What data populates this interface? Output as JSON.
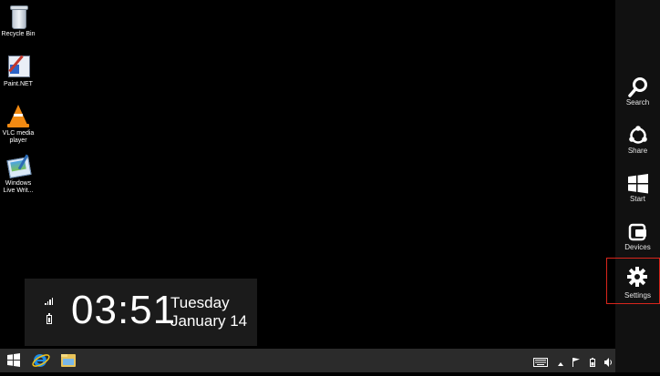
{
  "desktop": {
    "icons": [
      {
        "label": "Recycle Bin",
        "icon": "recycle-bin-icon"
      },
      {
        "label": "Paint.NET",
        "icon": "paint-net-icon"
      },
      {
        "label": "VLC media player",
        "icon": "vlc-icon"
      },
      {
        "label": "Windows Live Writ...",
        "icon": "windows-live-writer-icon"
      }
    ]
  },
  "clock": {
    "time": "03:51",
    "day": "Tuesday",
    "date": "January 14"
  },
  "charms": [
    {
      "label": "Search",
      "icon": "search-icon"
    },
    {
      "label": "Share",
      "icon": "share-icon"
    },
    {
      "label": "Start",
      "icon": "windows-logo-icon"
    },
    {
      "label": "Devices",
      "icon": "devices-icon"
    },
    {
      "label": "Settings",
      "icon": "gear-icon"
    }
  ],
  "colors": {
    "highlight": "#d9261c",
    "charms_bg": "#111111",
    "taskbar_bg": "#2b2b2b"
  }
}
